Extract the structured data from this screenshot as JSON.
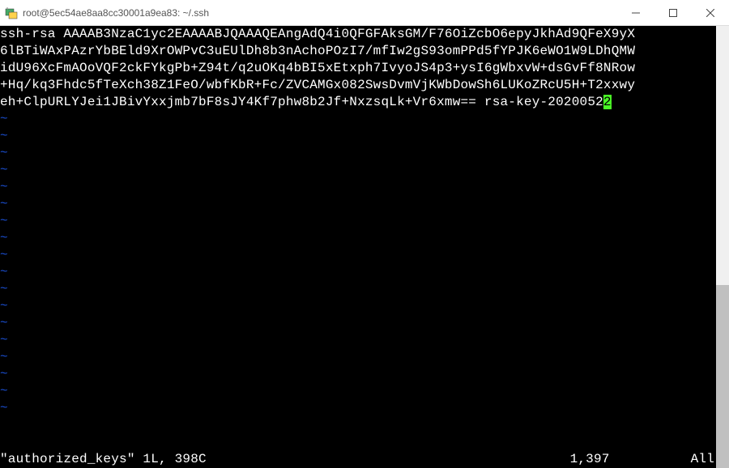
{
  "window": {
    "title": "root@5ec54ae8aa8cc30001a9ea83: ~/.ssh"
  },
  "terminal": {
    "lines": [
      "ssh-rsa AAAAB3NzaC1yc2EAAAABJQAAAQEAngAdQ4i0QFGFAksGM/F76OiZcbO6epyJkhAd9QFeX9yX",
      "6lBTiWAxPAzrYbBEld9XrOWPvC3uEUlDh8b3nAchoPOzI7/mfIw2gS93omPPd5fYPJK6eWO1W9LDhQMW",
      "idU96XcFmAOoVQF2ckFYkgPb+Z94t/q2uOKq4bBI5xEtxph7IvyoJS4p3+ysI6gWbxvW+dsGvFf8NRow",
      "+Hq/kq3Fhdc5fTeXch38Z1FeO/wbfKbR+Fc/ZVCAMGx082SwsDvmVjKWbDowSh6LUKoZRcU5H+T2xxwy",
      "eh+ClpURLYJei1JBivYxxjmb7bF8sJY4Kf7phw8b2Jf+NxzsqLk+Vr6xmw== rsa-key-20200522"
    ],
    "cursor_char": "2",
    "tilde_count": 18
  },
  "status": {
    "filename": "\"authorized_keys\" 1L, 398C",
    "position": "1,397",
    "percent": "All"
  }
}
